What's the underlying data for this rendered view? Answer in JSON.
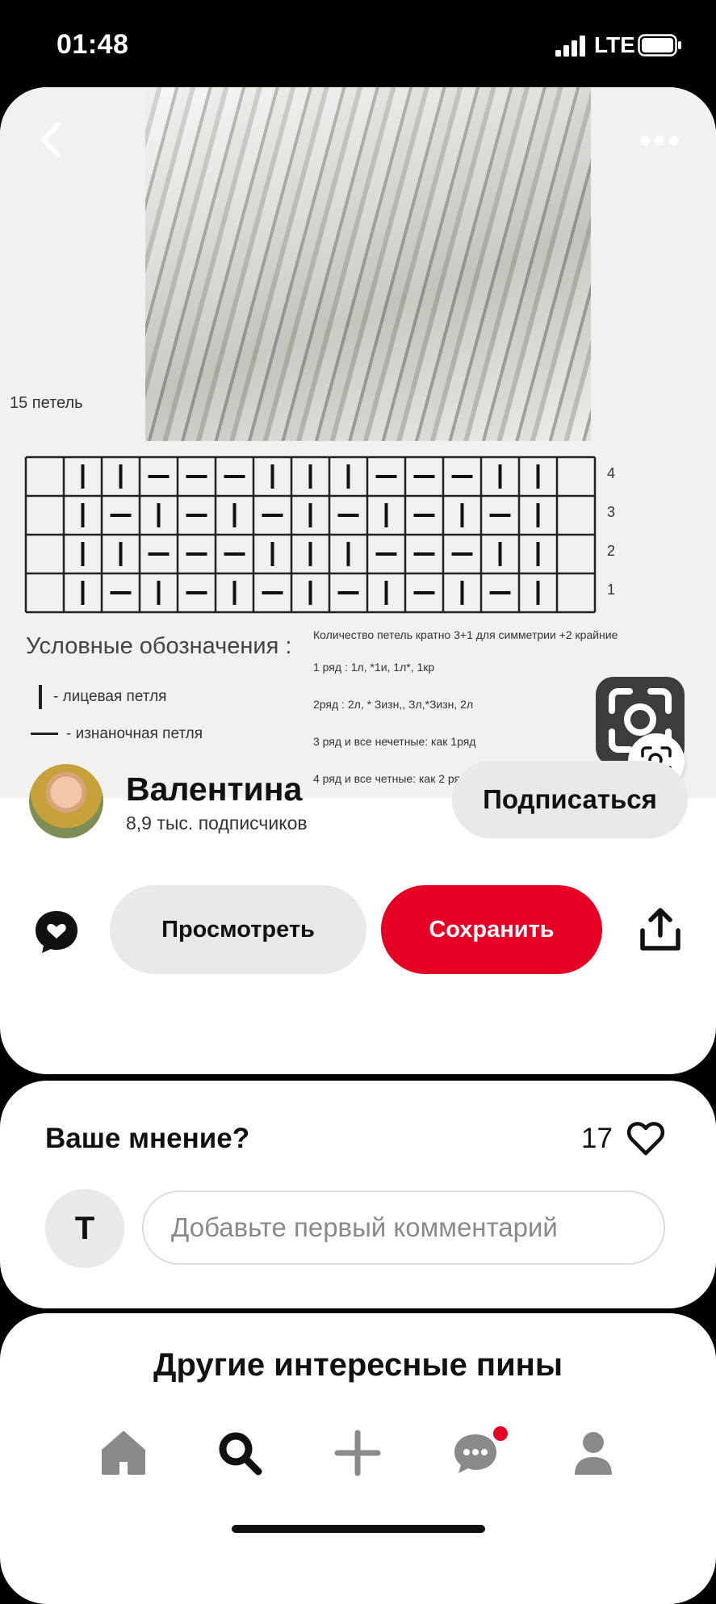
{
  "status_bar": {
    "time": "01:48",
    "network": "LTE"
  },
  "pin_image": {
    "stitch_count": "15 петель",
    "legend_title": "Условные обозначения :",
    "legend_knit": "- лицевая петля",
    "legend_purl": "- изнаночная петля",
    "row_numbers": [
      "4",
      "3",
      "2",
      "1"
    ],
    "notes": [
      "Количество петель кратно 3+1 для симметрии +2 крайние",
      "1 ряд :  1л, *1и, 1л*, 1кр",
      "2ряд :  2л, * Зизн,, Зл,*Зизн, 2л",
      "3 ряд  и все нечетные: как 1ряд",
      "4 ряд  и все четные: как 2 ряд"
    ]
  },
  "profile": {
    "name": "Валентина",
    "followers": "8,9 тыс. подписчиков",
    "follow_label": "Подписаться"
  },
  "actions": {
    "view_label": "Просмотреть",
    "save_label": "Сохранить"
  },
  "comments": {
    "title": "Ваше мнение?",
    "likes": "17",
    "user_initial": "T",
    "placeholder": "Добавьте первый комментарий"
  },
  "more_pins": {
    "title": "Другие интересные пины"
  },
  "colors": {
    "save": "#e60023",
    "notification_dot": "#e60023",
    "button_gray": "#e9e9e9"
  },
  "icons": [
    "back-icon",
    "more-icon",
    "visual-search-icon",
    "comment-icon",
    "share-icon",
    "heart-icon",
    "home-icon",
    "search-icon",
    "plus-icon",
    "messages-icon",
    "profile-icon"
  ]
}
